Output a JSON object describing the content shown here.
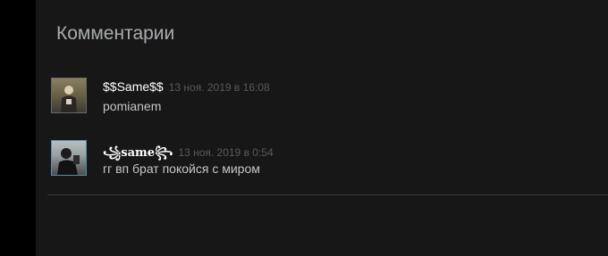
{
  "section": {
    "title": "Комментарии"
  },
  "comments": [
    {
      "author": "$$Same$$",
      "timestamp": "13 ноя. 2019 в 16:08",
      "text": "pomianem",
      "avatar": "user-avatar-icon"
    },
    {
      "author": "𝕾𝖆𝖒𝖊",
      "author_display": "꧁𝐬𝐚𝐦𝐞꧂",
      "timestamp": "13 ноя. 2019 в 0:54",
      "text": "гг вп брат покойся с миром",
      "avatar": "user-avatar-icon"
    }
  ],
  "colors": {
    "background": "#171717",
    "title": "#a8acb0",
    "author": "#ffffff",
    "timestamp": "#56595c",
    "text": "#c6c6c6",
    "divider": "#3a3a3a"
  }
}
